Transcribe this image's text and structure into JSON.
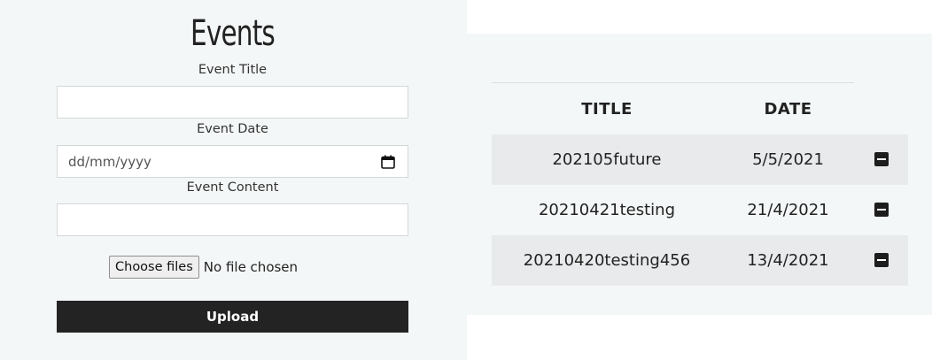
{
  "form": {
    "heading": "Events",
    "title_label": "Event Title",
    "title_value": "",
    "date_label": "Event Date",
    "date_placeholder": "dd/mm/yyyy",
    "content_label": "Event Content",
    "content_value": "",
    "choose_files_label": "Choose files",
    "no_file_text": "No file chosen",
    "upload_label": "Upload"
  },
  "table": {
    "headers": [
      "TITLE",
      "DATE"
    ],
    "rows": [
      {
        "title": "202105future",
        "date": "5/5/2021",
        "action_icon": "minus-square-icon"
      },
      {
        "title": "20210421testing",
        "date": "21/4/2021",
        "action_icon": "minus-square-icon"
      },
      {
        "title": "20210420testing456",
        "date": "13/4/2021",
        "action_icon": "minus-square-icon"
      }
    ]
  },
  "colors": {
    "panel_bg": "#f4f7f7",
    "striped_row": "#e8eaeb",
    "upload_button": "#232323"
  }
}
